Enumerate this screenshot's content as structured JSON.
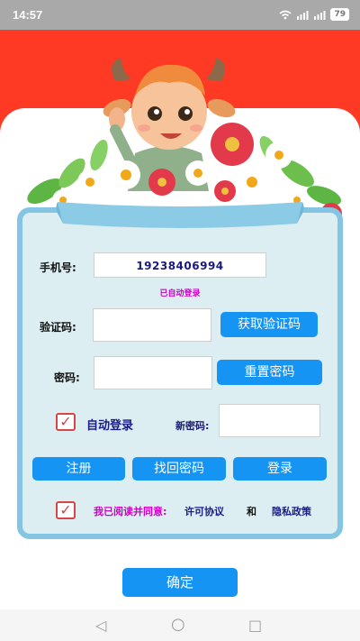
{
  "status_bar": {
    "time": "14:57",
    "signal1": "▂▄▆",
    "signal2": "▂▄▆",
    "wifi": "◠",
    "battery": "79"
  },
  "form": {
    "phone_label": "手机号:",
    "phone_value": "19238406994",
    "auto_login_hint": "已自动登录",
    "code_label": "验证码:",
    "get_code_button": "获取验证码",
    "password_label": "密码:",
    "reset_password_button": "重置密码",
    "auto_login_label": "自动登录",
    "auto_login_checked": true,
    "new_password_label": "新密码:",
    "register_button": "注册",
    "recover_button": "找回密码",
    "login_button": "登录"
  },
  "agreement": {
    "checked": true,
    "prefix": "我已阅读并同意:",
    "license": "许可协议",
    "and": "和",
    "privacy": "隐私政策"
  },
  "confirm_button": "确定",
  "nav": {
    "back": "◁",
    "home": "○",
    "recents": "□"
  },
  "colors": {
    "header_red": "#ff3a24",
    "primary_blue": "#1594f3",
    "panel_bg": "#dceef2",
    "panel_border": "#83c5e2",
    "hint_magenta": "#d000c8",
    "checkbox_red": "#d84545"
  },
  "icons": [
    "wifi-icon",
    "signal-icon",
    "battery-icon",
    "checkbox-checked-icon",
    "back-nav-icon",
    "home-nav-icon",
    "recents-nav-icon",
    "bull-mascot-illustration",
    "flowers-illustration"
  ]
}
